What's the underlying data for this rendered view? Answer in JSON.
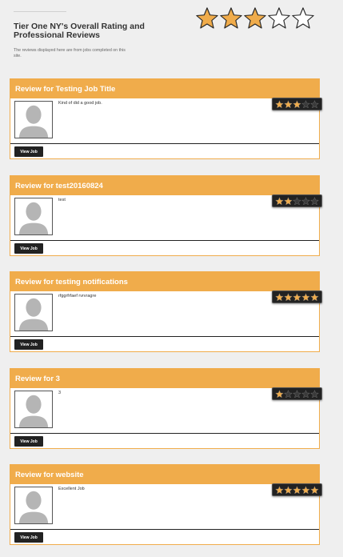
{
  "header": {
    "title": "Tier One NY's Overall Rating and Professional Reviews",
    "subtitle": "The reviews displayed here are from jobs completed on this site.",
    "overall_rating": 3,
    "max_rating": 5
  },
  "colors": {
    "accent": "#f0ac4b",
    "star_fill": "#f0ac4b",
    "button_bg": "#222222"
  },
  "reviews": [
    {
      "title": "Review for Testing Job Title",
      "text": "Kind of did a good job.",
      "rating": 3,
      "button_label": "View Job"
    },
    {
      "title": "Review for test20160824",
      "text": "test",
      "rating": 2,
      "button_label": "View Job"
    },
    {
      "title": "Review for testing notifications",
      "text": "rfggrfrfaef rvrvragre",
      "rating": 5,
      "button_label": "View Job"
    },
    {
      "title": "Review for 3",
      "text": "3",
      "rating": 1,
      "button_label": "View Job"
    },
    {
      "title": "Review for website",
      "text": "Excellent Job",
      "rating": 5,
      "button_label": "View Job"
    }
  ]
}
